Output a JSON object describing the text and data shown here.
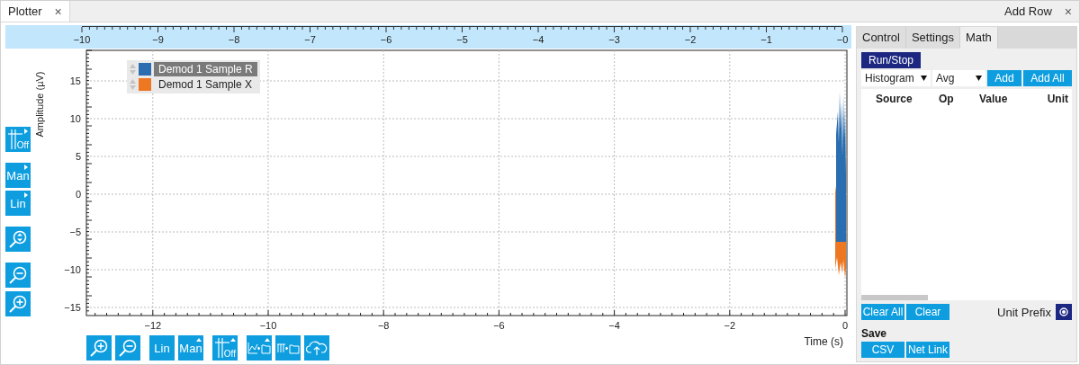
{
  "tabs": [
    {
      "label": "Plotter",
      "close": "×",
      "selected": true
    }
  ],
  "add_row": {
    "label": "Add Row",
    "close": "×"
  },
  "overview": {
    "tick_labels": [
      "−10",
      "−9",
      "−8",
      "−7",
      "−6",
      "−5",
      "−4",
      "−3",
      "−2",
      "−1",
      "−0"
    ]
  },
  "plot": {
    "y_label": "Amplitude (µV)",
    "x_label": "Time (s)",
    "y_tick_labels": [
      "15",
      "10",
      "5",
      "0",
      "−5",
      "−10",
      "−15"
    ],
    "x_tick_labels": [
      "−12",
      "−10",
      "−8",
      "−6",
      "−4",
      "−2",
      "0"
    ],
    "legend": [
      {
        "label": "Demod 1 Sample R",
        "color": "#2a6db0",
        "selected": true
      },
      {
        "label": "Demod 1 Sample X",
        "color": "#ee7722",
        "selected": false
      }
    ]
  },
  "left_toolbar": [
    [
      {
        "kind": "grid",
        "label": "Off",
        "has_menu": true
      }
    ],
    [
      {
        "kind": "text",
        "label": "Man",
        "has_menu": true
      },
      {
        "kind": "text",
        "label": "Lin",
        "has_menu": true
      }
    ],
    [
      {
        "kind": "zoom-fit",
        "has_menu": false
      }
    ],
    [
      {
        "kind": "zoom-out",
        "has_menu": false
      },
      {
        "kind": "zoom-in",
        "has_menu": false
      }
    ]
  ],
  "bottom_toolbar": [
    [
      {
        "kind": "zoom-in",
        "has_menu": false
      },
      {
        "kind": "zoom-out",
        "has_menu": false
      }
    ],
    [
      {
        "kind": "text",
        "label": "Lin",
        "has_menu": false
      },
      {
        "kind": "text",
        "label": "Man",
        "has_menu": true
      }
    ],
    [
      {
        "kind": "grid",
        "label": "Off",
        "has_menu": true
      }
    ],
    [
      {
        "kind": "export-plot",
        "has_menu": true
      },
      {
        "kind": "export-table",
        "has_menu": false
      },
      {
        "kind": "cloud",
        "has_menu": false
      }
    ]
  ],
  "panel": {
    "tabs": [
      {
        "label": "Control",
        "selected": false
      },
      {
        "label": "Settings",
        "selected": false
      },
      {
        "label": "Math",
        "selected": true
      }
    ],
    "run_stop": "Run/Stop",
    "selects": [
      "Histogram",
      "Avg"
    ],
    "add_buttons": [
      "Add",
      "Add All"
    ],
    "columns": [
      "Source",
      "Op",
      "Value",
      "Unit"
    ],
    "clear_buttons": [
      "Clear All",
      "Clear"
    ],
    "unit_prefix": {
      "label": "Unit Prefix",
      "on": true
    },
    "save": {
      "title": "Save",
      "buttons": [
        "CSV",
        "Net Link"
      ]
    }
  }
}
